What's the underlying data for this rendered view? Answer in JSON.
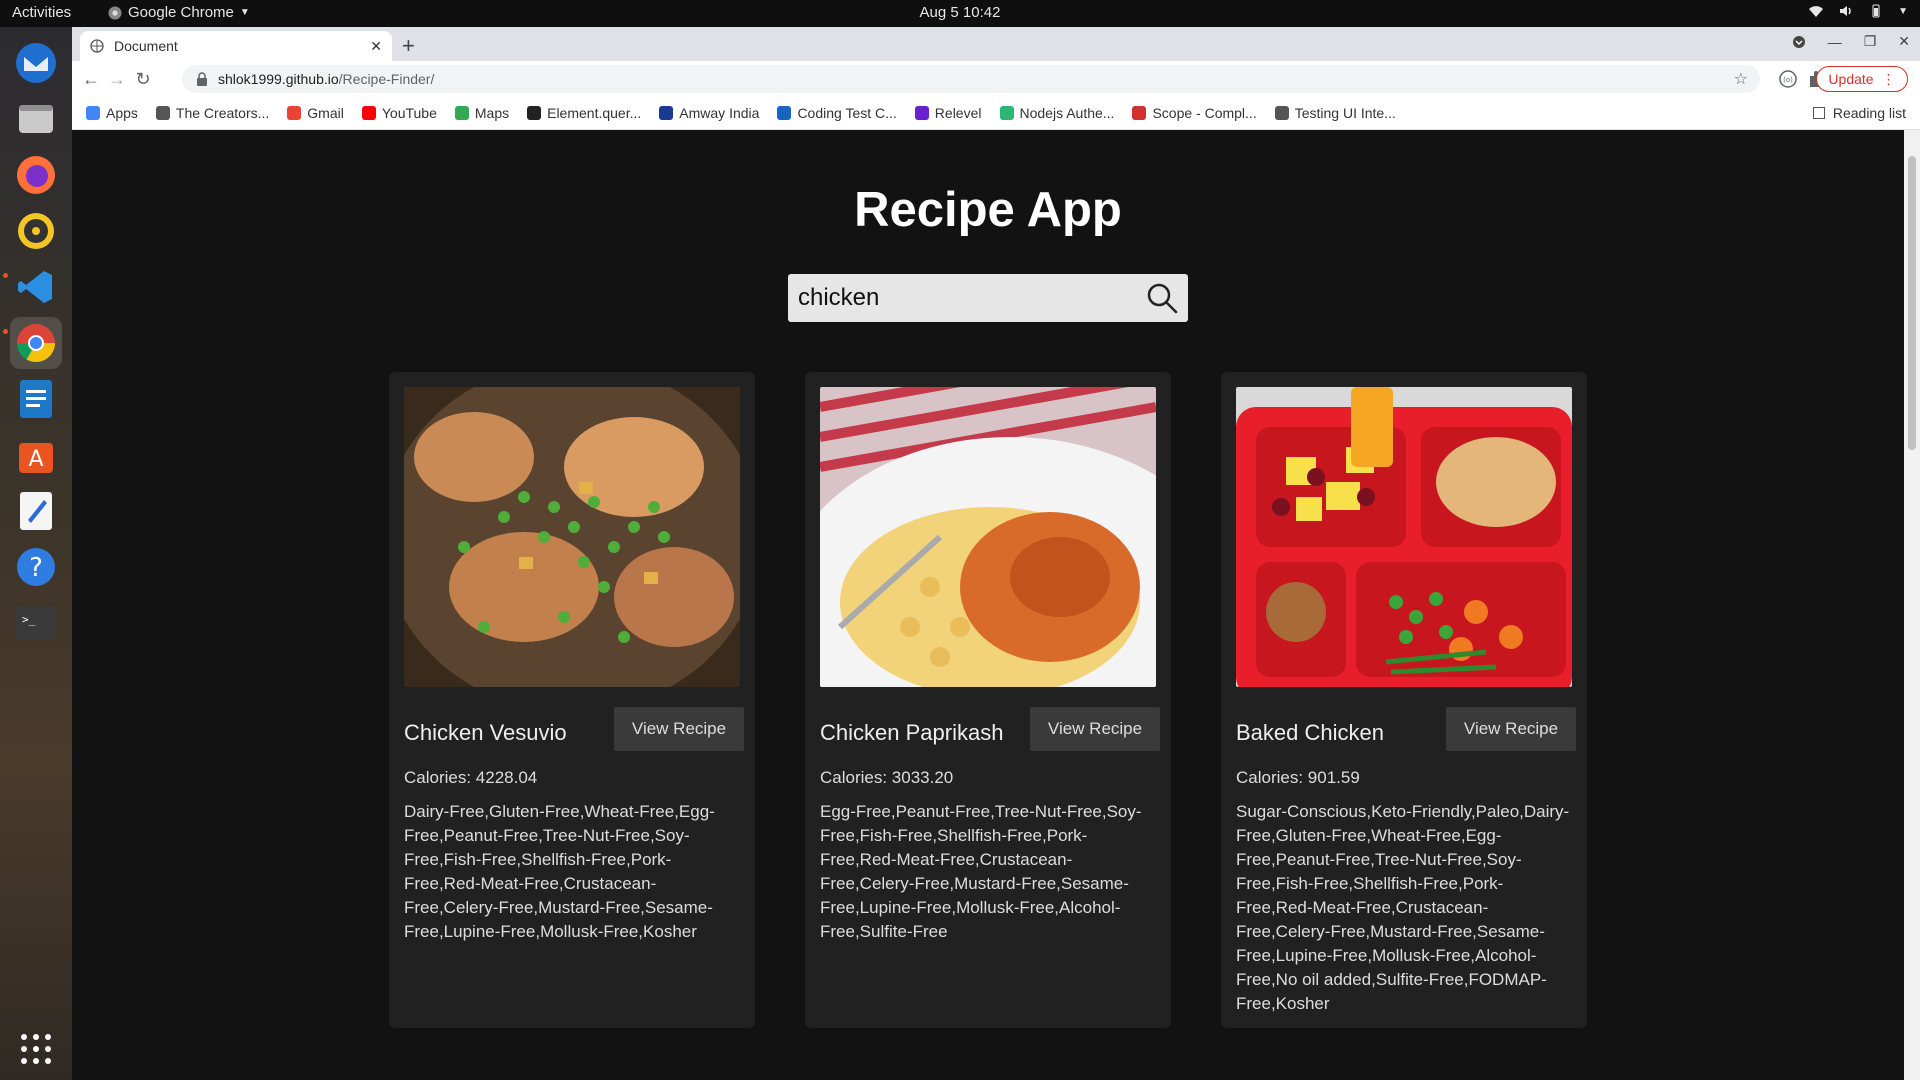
{
  "system": {
    "activities_label": "Activities",
    "app_name": "Google Chrome",
    "clock": "Aug 5  10:42"
  },
  "browser": {
    "tab_title": "Document",
    "url_host": "shlok1999.github.io",
    "url_path": "/Recipe-Finder/",
    "update_label": "Update",
    "reading_list_label": "Reading list",
    "bookmarks": [
      {
        "label": "Apps",
        "icon": "apps-grid-icon",
        "color": "#4285f4"
      },
      {
        "label": "The Creators...",
        "icon": "globe-icon",
        "color": "#555555"
      },
      {
        "label": "Gmail",
        "icon": "gmail-icon",
        "color": "#ea4335"
      },
      {
        "label": "YouTube",
        "icon": "youtube-icon",
        "color": "#ff0000"
      },
      {
        "label": "Maps",
        "icon": "maps-icon",
        "color": "#34a853"
      },
      {
        "label": "Element.quer...",
        "icon": "element-icon",
        "color": "#222222"
      },
      {
        "label": "Amway India",
        "icon": "amway-icon",
        "color": "#1a3a8f"
      },
      {
        "label": "Coding Test C...",
        "icon": "coding-test-icon",
        "color": "#1565c0"
      },
      {
        "label": "Relevel",
        "icon": "relevel-icon",
        "color": "#6a1fd0"
      },
      {
        "label": "Nodejs Authe...",
        "icon": "nodejs-icon",
        "color": "#2bb673"
      },
      {
        "label": "Scope - Compl...",
        "icon": "scope-icon",
        "color": "#d32f2f"
      },
      {
        "label": "Testing UI Inte...",
        "icon": "globe-icon",
        "color": "#555555"
      }
    ]
  },
  "page": {
    "title": "Recipe App",
    "search": {
      "value": "chicken",
      "placeholder": ""
    },
    "recipes": [
      {
        "name": "Chicken Vesuvio",
        "button": "View Recipe",
        "calories": "Calories: 4228.04",
        "labels": "Dairy-Free,Gluten-Free,Wheat-Free,Egg-Free,Peanut-Free,Tree-Nut-Free,Soy-Free,Fish-Free,Shellfish-Free,Pork-Free,Red-Meat-Free,Crustacean-Free,Celery-Free,Mustard-Free,Sesame-Free,Lupine-Free,Mollusk-Free,Kosher"
      },
      {
        "name": "Chicken Paprikash",
        "button": "View Recipe",
        "calories": "Calories: 3033.20",
        "labels": "Egg-Free,Peanut-Free,Tree-Nut-Free,Soy-Free,Fish-Free,Shellfish-Free,Pork-Free,Red-Meat-Free,Crustacean-Free,Celery-Free,Mustard-Free,Sesame-Free,Lupine-Free,Mollusk-Free,Alcohol-Free,Sulfite-Free"
      },
      {
        "name": "Baked Chicken",
        "button": "View Recipe",
        "calories": "Calories: 901.59",
        "labels": "Sugar-Conscious,Keto-Friendly,Paleo,Dairy-Free,Gluten-Free,Wheat-Free,Egg-Free,Peanut-Free,Tree-Nut-Free,Soy-Free,Fish-Free,Shellfish-Free,Pork-Free,Red-Meat-Free,Crustacean-Free,Celery-Free,Mustard-Free,Sesame-Free,Lupine-Free,Mollusk-Free,Alcohol-Free,No oil added,Sulfite-Free,FODMAP-Free,Kosher"
      }
    ]
  }
}
